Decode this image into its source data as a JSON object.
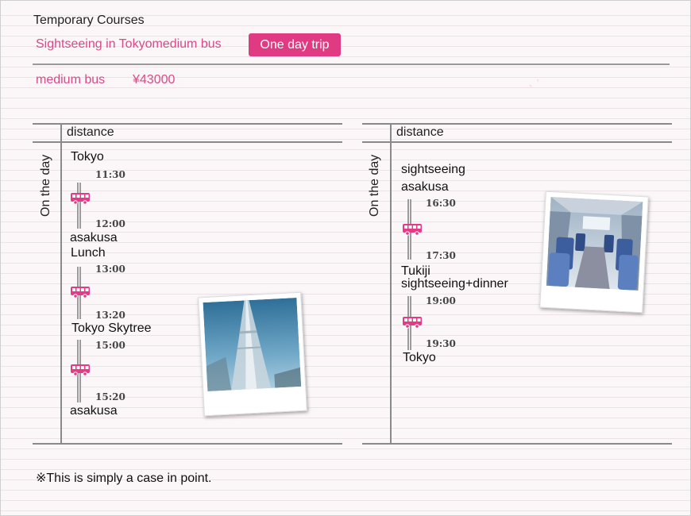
{
  "header": {
    "title": "Temporary Courses",
    "course_name": "Sightseeing in Tokyomedium bus",
    "trip_badge": "One day trip",
    "price_label": "medium bus",
    "price_value": "¥43000"
  },
  "left_schedule": {
    "column_header": "distance",
    "day_label": "On the day",
    "stops": [
      "Tokyo",
      "asakusa",
      "Lunch",
      "Tokyo Skytree",
      "asakusa"
    ],
    "times": [
      "11:30",
      "12:00",
      "13:00",
      "13:20",
      "15:00",
      "15:20"
    ]
  },
  "right_schedule": {
    "column_header": "distance",
    "day_label": "On the day",
    "stops": [
      "sightseeing",
      "asakusa",
      "Tukiji",
      "sightseeing+dinner",
      "Tokyo"
    ],
    "times": [
      "16:30",
      "17:30",
      "19:00",
      "19:30"
    ]
  },
  "icons": {
    "bus": "bus-icon",
    "photo_left": "tokyo-skytree-photo",
    "photo_right": "bus-interior-photo"
  },
  "colors": {
    "accent": "#e03a82",
    "accent_text": "#d94a88",
    "bus_icon": "#e53a86"
  },
  "footer": {
    "note": "※This is simply a case in point."
  }
}
